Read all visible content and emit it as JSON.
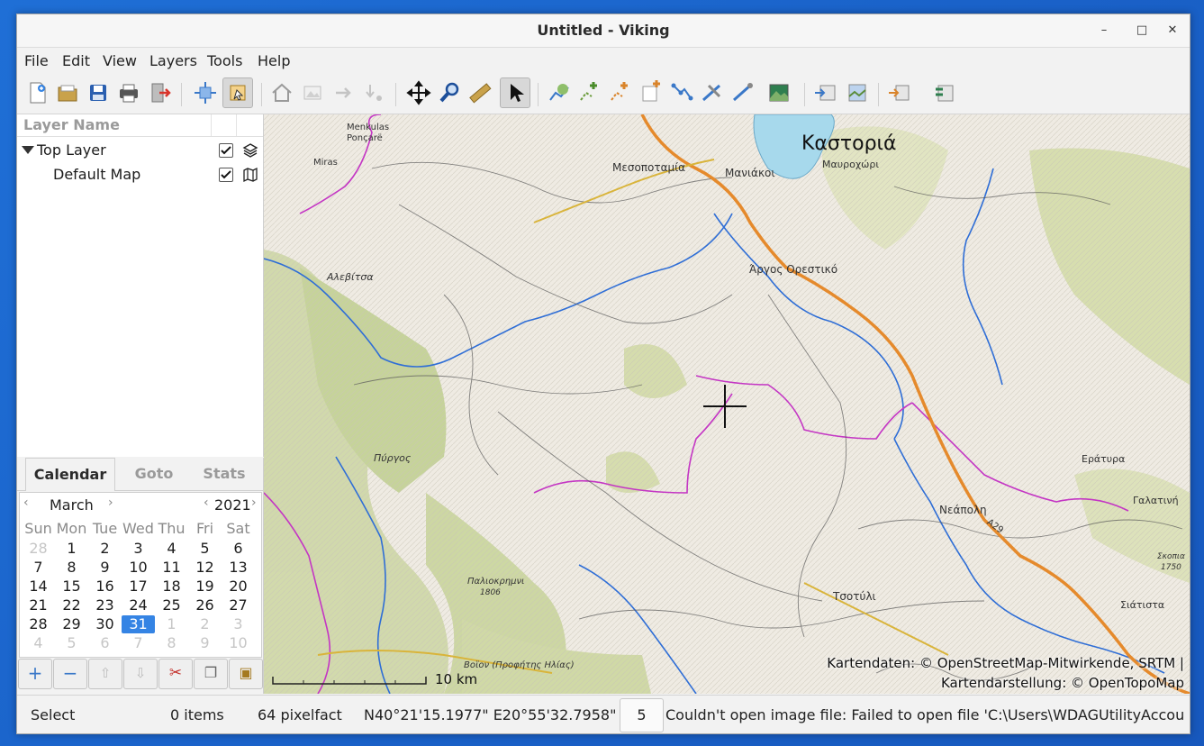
{
  "window": {
    "title": "Untitled - Viking",
    "controls": {
      "minimize": "–",
      "maximize": "□",
      "close": "✕"
    }
  },
  "menu": [
    "File",
    "Edit",
    "View",
    "Layers",
    "Tools",
    "Help"
  ],
  "layers_panel": {
    "header": "Layer Name",
    "items": [
      {
        "label": "Top Layer",
        "checked": true,
        "icon": "layers-icon"
      },
      {
        "label": "Default Map",
        "checked": true,
        "icon": "map-icon"
      }
    ]
  },
  "side_tabs": [
    "Calendar",
    "Goto",
    "Stats"
  ],
  "calendar": {
    "month": "March",
    "year": "2021",
    "weekdays": [
      "Sun",
      "Mon",
      "Tue",
      "Wed",
      "Thu",
      "Fri",
      "Sat"
    ],
    "weeks": [
      [
        "28",
        "1",
        "2",
        "3",
        "4",
        "5",
        "6"
      ],
      [
        "7",
        "8",
        "9",
        "10",
        "11",
        "12",
        "13"
      ],
      [
        "14",
        "15",
        "16",
        "17",
        "18",
        "19",
        "20"
      ],
      [
        "21",
        "22",
        "23",
        "24",
        "25",
        "26",
        "27"
      ],
      [
        "28",
        "29",
        "30",
        "31",
        "1",
        "2",
        "3"
      ],
      [
        "4",
        "5",
        "6",
        "7",
        "8",
        "9",
        "10"
      ]
    ],
    "selected_day": "31"
  },
  "map": {
    "labels": {
      "kastoria": "Καστοριά",
      "mavrochori": "Μαυροχώρι",
      "mesopotamia": "Μεσοποταμία",
      "maniakoi": "Μανιάκοι",
      "argos": "Άργος Ορεστικό",
      "alevitsa": "Αλεβίτσα",
      "pyrgos": "Πύργος",
      "paliokrimni": "Παλιοκρημνι",
      "paliokrimni_elev": "1806",
      "voion": "Βοϊον (Προφήτης Ηλίας)",
      "neapoli": "Νεάπολη",
      "tsotyli": "Τσοτύλι",
      "eratyra": "Εράτυρα",
      "galatini": "Γαλατινή",
      "siatista": "Σιάτιστα",
      "skopia": "Σκοπια",
      "skopia_elev": "1750",
      "menkulas": "Menkulas",
      "poncare": "Ponçarë",
      "miras": "Miras",
      "a29": "A29"
    },
    "scale_label": "10 km",
    "attribution_line1": "Kartendaten: © OpenStreetMap-Mitwirkende, SRTM |",
    "attribution_line2": "Kartendarstellung: © OpenTopoMap"
  },
  "statusbar": {
    "tool": "Select",
    "items": "0 items",
    "zoom": "64 pixelfact",
    "coords": "N40°21'15.1977\" E20°55'32.7958\"",
    "spin_value": "5",
    "message": "Couldn't open image file: Failed to open file 'C:\\Users\\WDAGUtilityAccount\\..."
  },
  "colors": {
    "accent": "#3584e4",
    "lake": "#a7d9ec",
    "river": "#2f6ed6",
    "border": "#c436c4",
    "motorway": "#e58a2c"
  }
}
